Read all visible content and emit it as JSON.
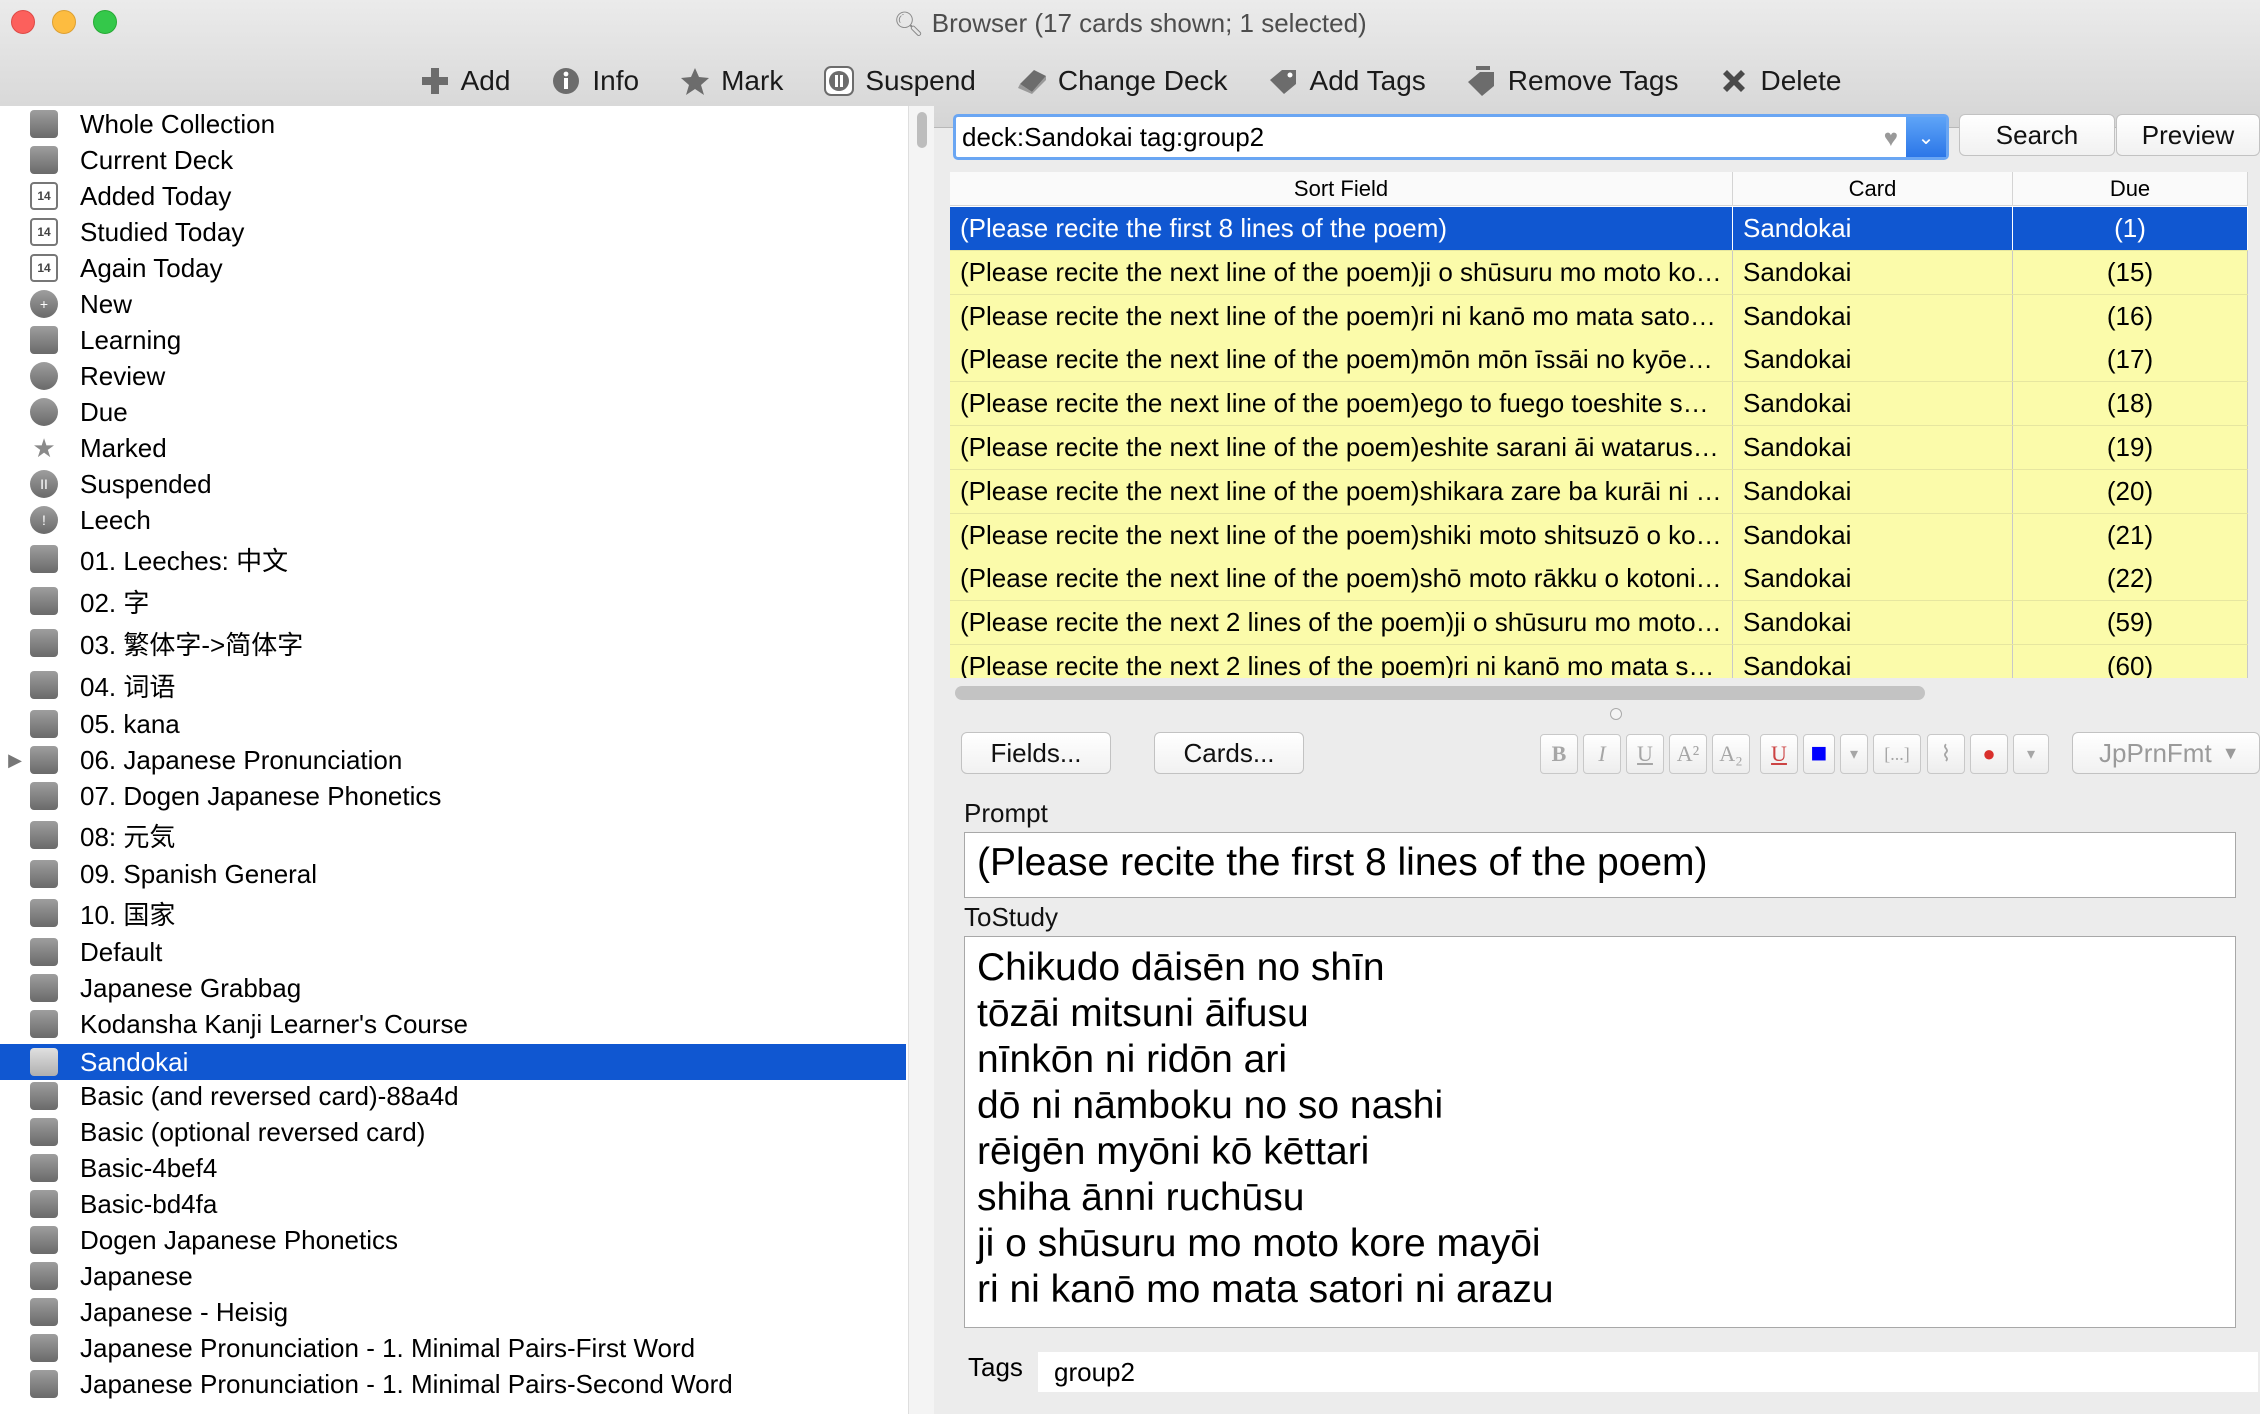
{
  "window": {
    "title": "Browser (17 cards shown; 1 selected)"
  },
  "toolbar": {
    "buttons": [
      {
        "label": "Add",
        "icon": "add-icon"
      },
      {
        "label": "Info",
        "icon": "info-icon"
      },
      {
        "label": "Mark",
        "icon": "star-icon"
      },
      {
        "label": "Suspend",
        "icon": "pause-icon"
      },
      {
        "label": "Change Deck",
        "icon": "deck-icon"
      },
      {
        "label": "Add Tags",
        "icon": "add-tags-icon"
      },
      {
        "label": "Remove Tags",
        "icon": "remove-tags-icon"
      },
      {
        "label": "Delete",
        "icon": "delete-icon"
      }
    ]
  },
  "sidebar": {
    "items": [
      {
        "label": "Whole Collection",
        "icon": "collection-icon"
      },
      {
        "label": "Current Deck",
        "icon": "deck-icon"
      },
      {
        "label": "Added Today",
        "icon": "calendar-icon",
        "glyph": "14"
      },
      {
        "label": "Studied Today",
        "icon": "calendar-icon",
        "glyph": "14"
      },
      {
        "label": "Again Today",
        "icon": "calendar-icon",
        "glyph": "14"
      },
      {
        "label": "New",
        "icon": "plus-circle-icon",
        "glyph": "+"
      },
      {
        "label": "Learning",
        "icon": "book-icon"
      },
      {
        "label": "Review",
        "icon": "clock-icon"
      },
      {
        "label": "Due",
        "icon": "clock-icon"
      },
      {
        "label": "Marked",
        "icon": "star-icon",
        "glyph": "★"
      },
      {
        "label": "Suspended",
        "icon": "pause-icon",
        "glyph": "II"
      },
      {
        "label": "Leech",
        "icon": "warning-icon",
        "glyph": "!"
      },
      {
        "label": "01. Leeches: 中文",
        "icon": "deck-icon"
      },
      {
        "label": "02. 字",
        "icon": "deck-icon"
      },
      {
        "label": "03. 繁体字->简体字",
        "icon": "deck-icon"
      },
      {
        "label": "04. 词语",
        "icon": "deck-icon"
      },
      {
        "label": "05. kana",
        "icon": "deck-icon"
      },
      {
        "label": "06. Japanese Pronunciation",
        "icon": "deck-icon",
        "expandable": true
      },
      {
        "label": "07. Dogen Japanese Phonetics",
        "icon": "deck-icon"
      },
      {
        "label": "08: 元気",
        "icon": "deck-icon"
      },
      {
        "label": "09. Spanish General",
        "icon": "deck-icon"
      },
      {
        "label": "10. 国家",
        "icon": "deck-icon"
      },
      {
        "label": "Default",
        "icon": "deck-icon"
      },
      {
        "label": "Japanese Grabbag",
        "icon": "deck-icon"
      },
      {
        "label": "Kodansha Kanji Learner's Course",
        "icon": "deck-icon"
      },
      {
        "label": "Sandokai",
        "icon": "deck-icon",
        "selected": true
      },
      {
        "label": "Basic (and reversed card)-88a4d",
        "icon": "note-type-icon"
      },
      {
        "label": "Basic (optional reversed card)",
        "icon": "note-type-icon"
      },
      {
        "label": "Basic-4bef4",
        "icon": "note-type-icon"
      },
      {
        "label": "Basic-bd4fa",
        "icon": "note-type-icon"
      },
      {
        "label": "Dogen Japanese Phonetics",
        "icon": "note-type-icon"
      },
      {
        "label": "Japanese",
        "icon": "note-type-icon"
      },
      {
        "label": "Japanese - Heisig",
        "icon": "note-type-icon"
      },
      {
        "label": "Japanese Pronunciation - 1. Minimal Pairs-First Word",
        "icon": "note-type-icon"
      },
      {
        "label": "Japanese Pronunciation - 1. Minimal Pairs-Second Word",
        "icon": "note-type-icon"
      }
    ]
  },
  "search": {
    "query": "deck:Sandokai tag:group2",
    "search_label": "Search",
    "preview_label": "Preview"
  },
  "table": {
    "columns": [
      "Sort Field",
      "Card",
      "Due"
    ],
    "rows": [
      {
        "sort": "(Please recite the first 8 lines of the poem)",
        "card": "Sandokai",
        "due": "(1)",
        "selected": true
      },
      {
        "sort": "(Please recite the next line of the poem)ji o shūsuru mo moto ko…",
        "card": "Sandokai",
        "due": "(15)"
      },
      {
        "sort": "(Please recite the next line of the poem)ri ni kanō mo mata sato…",
        "card": "Sandokai",
        "due": "(16)"
      },
      {
        "sort": "(Please recite the next line of the poem)mōn mōn īssāi no kyōe…",
        "card": "Sandokai",
        "due": "(17)"
      },
      {
        "sort": "(Please recite the next line of the poem)ego to fuego toeshite s…",
        "card": "Sandokai",
        "due": "(18)"
      },
      {
        "sort": "(Please recite the next line of the poem)eshite sarani āi watarus…",
        "card": "Sandokai",
        "due": "(19)"
      },
      {
        "sort": "(Please recite the next line of the poem)shikara zare ba kurāi ni …",
        "card": "Sandokai",
        "due": "(20)"
      },
      {
        "sort": "(Please recite the next line of the poem)shiki moto shitsuzō o ko…",
        "card": "Sandokai",
        "due": "(21)"
      },
      {
        "sort": "(Please recite the next line of the poem)shō moto rākku o kotoni…",
        "card": "Sandokai",
        "due": "(22)"
      },
      {
        "sort": "(Please recite the next 2 lines of the poem)ji o shūsuru mo moto…",
        "card": "Sandokai",
        "due": "(59)"
      },
      {
        "sort": "(Please recite the next 2 lines of the poem)ri ni kanō mo mata s…",
        "card": "Sandokai",
        "due": "(60)"
      }
    ]
  },
  "editor": {
    "fields_button": "Fields...",
    "cards_button": "Cards...",
    "format_buttons": [
      {
        "glyph": "B",
        "icon": "bold-icon"
      },
      {
        "glyph": "I",
        "icon": "italic-icon"
      },
      {
        "glyph": "U",
        "icon": "underline-icon"
      },
      {
        "glyph": "A²",
        "icon": "superscript-icon"
      },
      {
        "glyph": "A₂",
        "icon": "subscript-icon"
      },
      {
        "glyph": "U",
        "icon": "clear-format-icon"
      },
      {
        "glyph": "■",
        "icon": "text-color-icon"
      },
      {
        "glyph": "▾",
        "icon": "color-dropdown-icon"
      },
      {
        "glyph": "[...]",
        "icon": "cloze-icon"
      },
      {
        "glyph": "⌇",
        "icon": "attach-icon"
      },
      {
        "glyph": "●",
        "icon": "record-icon"
      },
      {
        "glyph": "▾",
        "icon": "more-dropdown-icon"
      }
    ],
    "text_color": "#0000ff",
    "record_color": "#d9302c",
    "plugin_label": "JpPrnFmt",
    "fields": {
      "prompt_label": "Prompt",
      "prompt_value": "(Please recite the first 8 lines of the poem)",
      "tostudy_label": "ToStudy",
      "tostudy_lines": [
        "Chikudo dāisēn no shīn",
        "tōzāi mitsuni āifusu",
        "nīnkōn ni ridōn ari",
        "dō ni nāmboku no so nashi",
        "rēigēn myōni kō kēttari",
        "shiha ānni ruchūsu",
        "ji o shūsuru mo moto kore mayōi",
        "ri ni kanō mo mata satori ni arazu"
      ]
    },
    "tags_label": "Tags",
    "tags_value": "group2"
  },
  "colors": {
    "selection": "#1057d1",
    "row_highlight": "#fbfbaa",
    "search_focus": "#6aa6f3"
  }
}
